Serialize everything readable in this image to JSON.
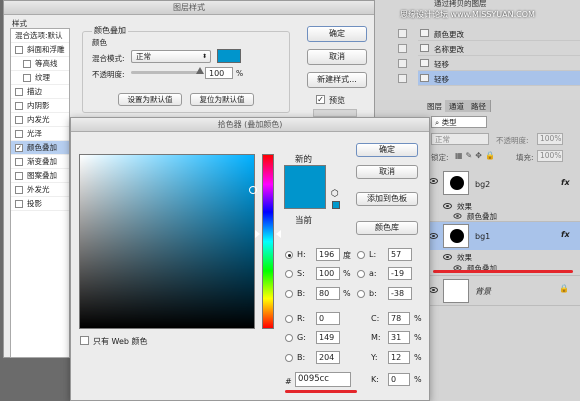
{
  "history": {
    "top_partial": "通过拷贝的图层",
    "items": [
      {
        "label": "颜色更改",
        "selected": false
      },
      {
        "label": "名称更改",
        "selected": false
      },
      {
        "label": "轻移",
        "selected": false
      },
      {
        "label": "轻移",
        "selected": true
      }
    ],
    "watermark": "思缘设计论坛 www.MISSYUAN.COM"
  },
  "layers_panel": {
    "tabs": [
      "图层",
      "通道",
      "路径"
    ],
    "kind_filter": "类型",
    "blend_mode": "正常",
    "opacity_label": "不透明度:",
    "opacity_value": "100%",
    "lock_label": "锁定:",
    "fill_label": "填充:",
    "fill_value": "100%",
    "layers": [
      {
        "name": "bg2",
        "fx": "fx",
        "effects_label": "效果",
        "effect": "颜色叠加",
        "selected": false
      },
      {
        "name": "bg1",
        "fx": "fx",
        "effects_label": "效果",
        "effect": "颜色叠加",
        "selected": true
      },
      {
        "name": "背景",
        "fx": "",
        "effects_label": "",
        "effect": "",
        "selected": false
      }
    ]
  },
  "layer_style": {
    "title": "图层样式",
    "styles_header": "样式",
    "blend_options": "混合选项:默认",
    "items": [
      {
        "label": "斜面和浮雕",
        "checked": false
      },
      {
        "label": "等高线",
        "checked": false
      },
      {
        "label": "纹理",
        "checked": false
      },
      {
        "label": "描边",
        "checked": false
      },
      {
        "label": "内阴影",
        "checked": false
      },
      {
        "label": "内发光",
        "checked": false
      },
      {
        "label": "光泽",
        "checked": false
      },
      {
        "label": "颜色叠加",
        "checked": true
      },
      {
        "label": "渐变叠加",
        "checked": false
      },
      {
        "label": "图案叠加",
        "checked": false
      },
      {
        "label": "外发光",
        "checked": false
      },
      {
        "label": "投影",
        "checked": false
      }
    ],
    "section_title": "颜色叠加",
    "sub_title": "颜色",
    "blend_mode_label": "混合模式:",
    "blend_mode_value": "正常",
    "opacity_label": "不透明度:",
    "opacity_value": "100",
    "opacity_unit": "%",
    "set_default": "设置为默认值",
    "reset_default": "复位为默认值",
    "ok": "确定",
    "cancel": "取消",
    "new_style": "新建样式...",
    "preview": "预览",
    "preview_checked": true,
    "swatch_color": "#0095cc"
  },
  "color_picker": {
    "title": "拾色器 (叠加颜色)",
    "new_label": "新的",
    "current_label": "当前",
    "new_color": "#0095cc",
    "current_color": "#0095cc",
    "ok": "确定",
    "cancel": "取消",
    "add_swatch": "添加到色板",
    "color_libraries": "颜色库",
    "web_only": "只有 Web 颜色",
    "hsb": {
      "h": "196",
      "h_unit": "度",
      "s": "100",
      "b": "80"
    },
    "rgb": {
      "r": "0",
      "g": "149",
      "b": "204"
    },
    "lab": {
      "l": "57",
      "a": "-19",
      "b": "-38"
    },
    "cmyk": {
      "c": "78",
      "m": "31",
      "y": "12",
      "k": "0"
    },
    "hex_label": "#",
    "hex": "0095cc",
    "labels": {
      "h": "H:",
      "s": "S:",
      "bb": "B:",
      "r": "R:",
      "g": "G:",
      "b": "B:",
      "l": "L:",
      "a": "a:",
      "lab_b": "b:",
      "c": "C:",
      "m": "M:",
      "y": "Y:",
      "k": "K:"
    },
    "percent": "%",
    "hue_marker_fraction": 0.455,
    "field_marker_fraction_x": 1.0,
    "field_marker_fraction_y": 0.2
  },
  "annotation_color": "#e4262b"
}
